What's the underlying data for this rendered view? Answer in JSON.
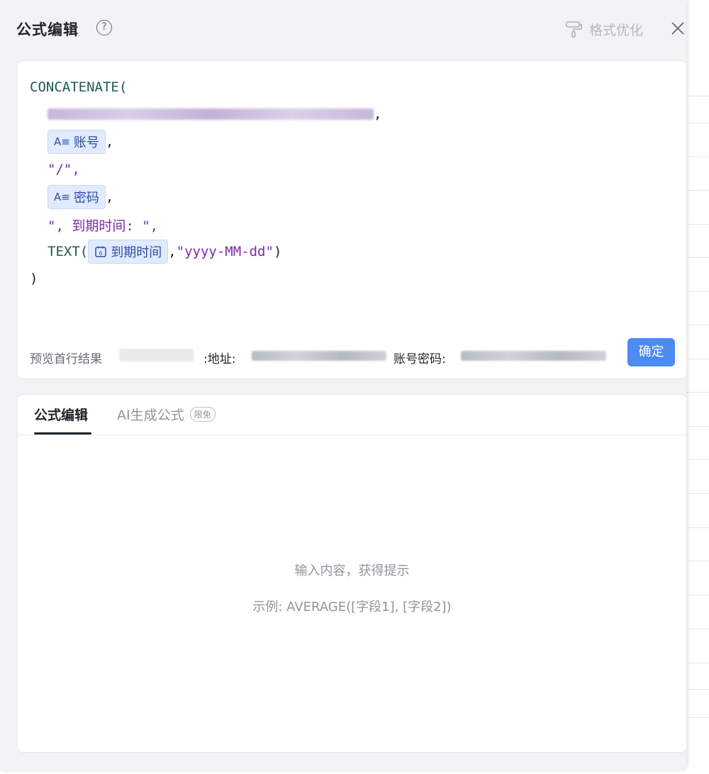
{
  "dialog": {
    "title": "公式编辑",
    "format_label": "格式优化"
  },
  "formula": {
    "function_outer": "CONCATENATE(",
    "line1_suffix": ",",
    "field_account": "账号",
    "field_password": "密码",
    "sep_string": "\"/\",",
    "expire_string": "\", 到期时间: \",",
    "text_fn": "TEXT(",
    "field_expire": "到期时间",
    "date_format": "\"yyyy-MM-dd\"",
    "close_paren": ")",
    "outer_close": ")",
    "comma": ","
  },
  "preview": {
    "label": "预览首行结果",
    "address_label": ":地址:",
    "account_label": "账号密码:"
  },
  "confirm_label": "确定",
  "tabs": [
    {
      "label": "公式编辑",
      "active": true
    },
    {
      "label": "AI生成公式",
      "badge": "限免",
      "active": false
    }
  ],
  "hint": {
    "title": "输入内容，获得提示",
    "example": "示例: AVERAGE([字段1], [字段2])"
  },
  "colors": {
    "accent": "#4c8af4",
    "chip_bg": "#e1eaff",
    "function": "#1e5a4f",
    "string": "#7b2aa6"
  },
  "icons": [
    "help-icon",
    "paint-roller-icon",
    "close-icon",
    "text-field-icon",
    "date-field-icon"
  ]
}
